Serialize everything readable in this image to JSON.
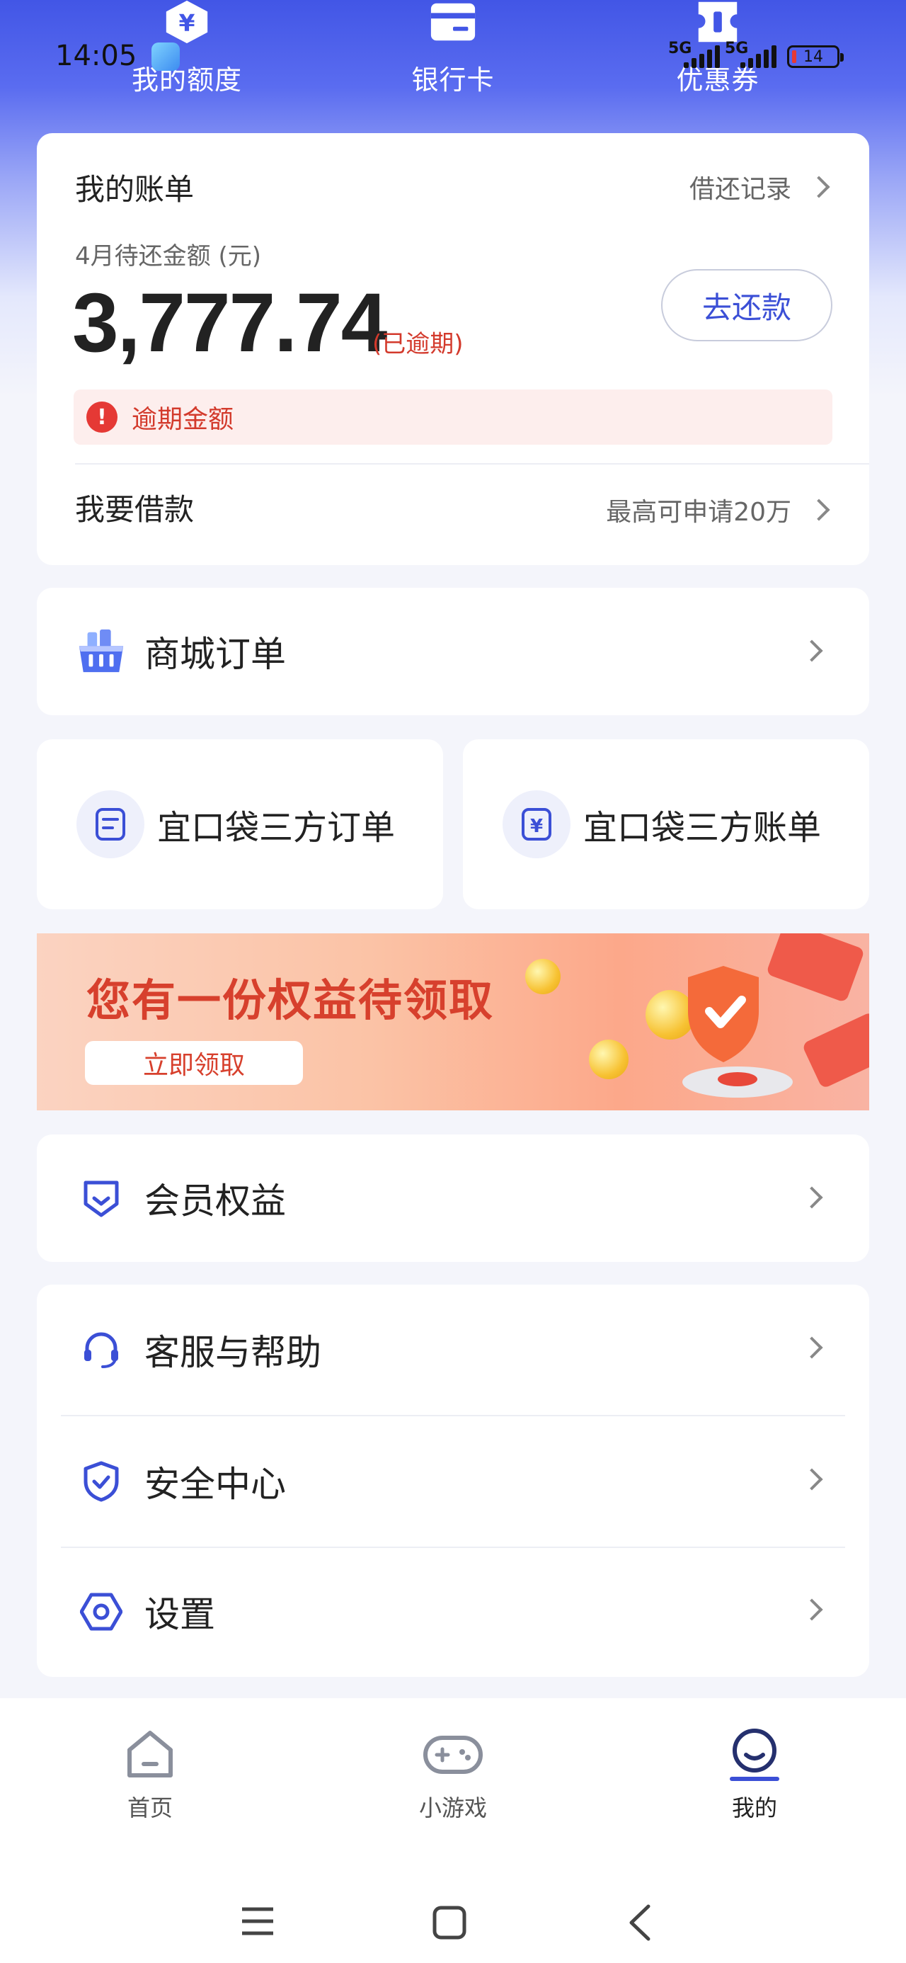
{
  "status": {
    "time": "14:05",
    "network1": "5G",
    "network2": "5G",
    "battery": "14"
  },
  "topnav": [
    {
      "label": "我的额度",
      "icon": "yuan-coin-icon"
    },
    {
      "label": "银行卡",
      "icon": "bank-card-icon"
    },
    {
      "label": "优惠券",
      "icon": "coupon-icon"
    }
  ],
  "bill": {
    "title": "我的账单",
    "history_link": "借还记录",
    "sub_label": "4月待还金额 (元)",
    "amount": "3,777.74",
    "overdue_tag": "(已逾期)",
    "repay_button": "去还款",
    "overdue_notice": "逾期金额",
    "borrow_title": "我要借款",
    "borrow_hint": "最高可申请20万"
  },
  "mall_order": {
    "label": "商城订单"
  },
  "third_party": {
    "orders": "宜口袋三方订单",
    "bills": "宜口袋三方账单"
  },
  "banner": {
    "title": "您有一份权益待领取",
    "button": "立即领取"
  },
  "membership": {
    "label": "会员权益"
  },
  "menu": [
    {
      "label": "客服与帮助",
      "icon": "headset-icon"
    },
    {
      "label": "安全中心",
      "icon": "shield-check-icon"
    },
    {
      "label": "设置",
      "icon": "settings-hexagon-icon"
    }
  ],
  "tabs": [
    {
      "label": "首页",
      "icon": "home-icon"
    },
    {
      "label": "小游戏",
      "icon": "gamepad-icon"
    },
    {
      "label": "我的",
      "icon": "profile-icon"
    }
  ],
  "colors": {
    "brand": "#3b4fd6",
    "overdue": "#d33a2c",
    "hero_top": "#4256e6"
  }
}
